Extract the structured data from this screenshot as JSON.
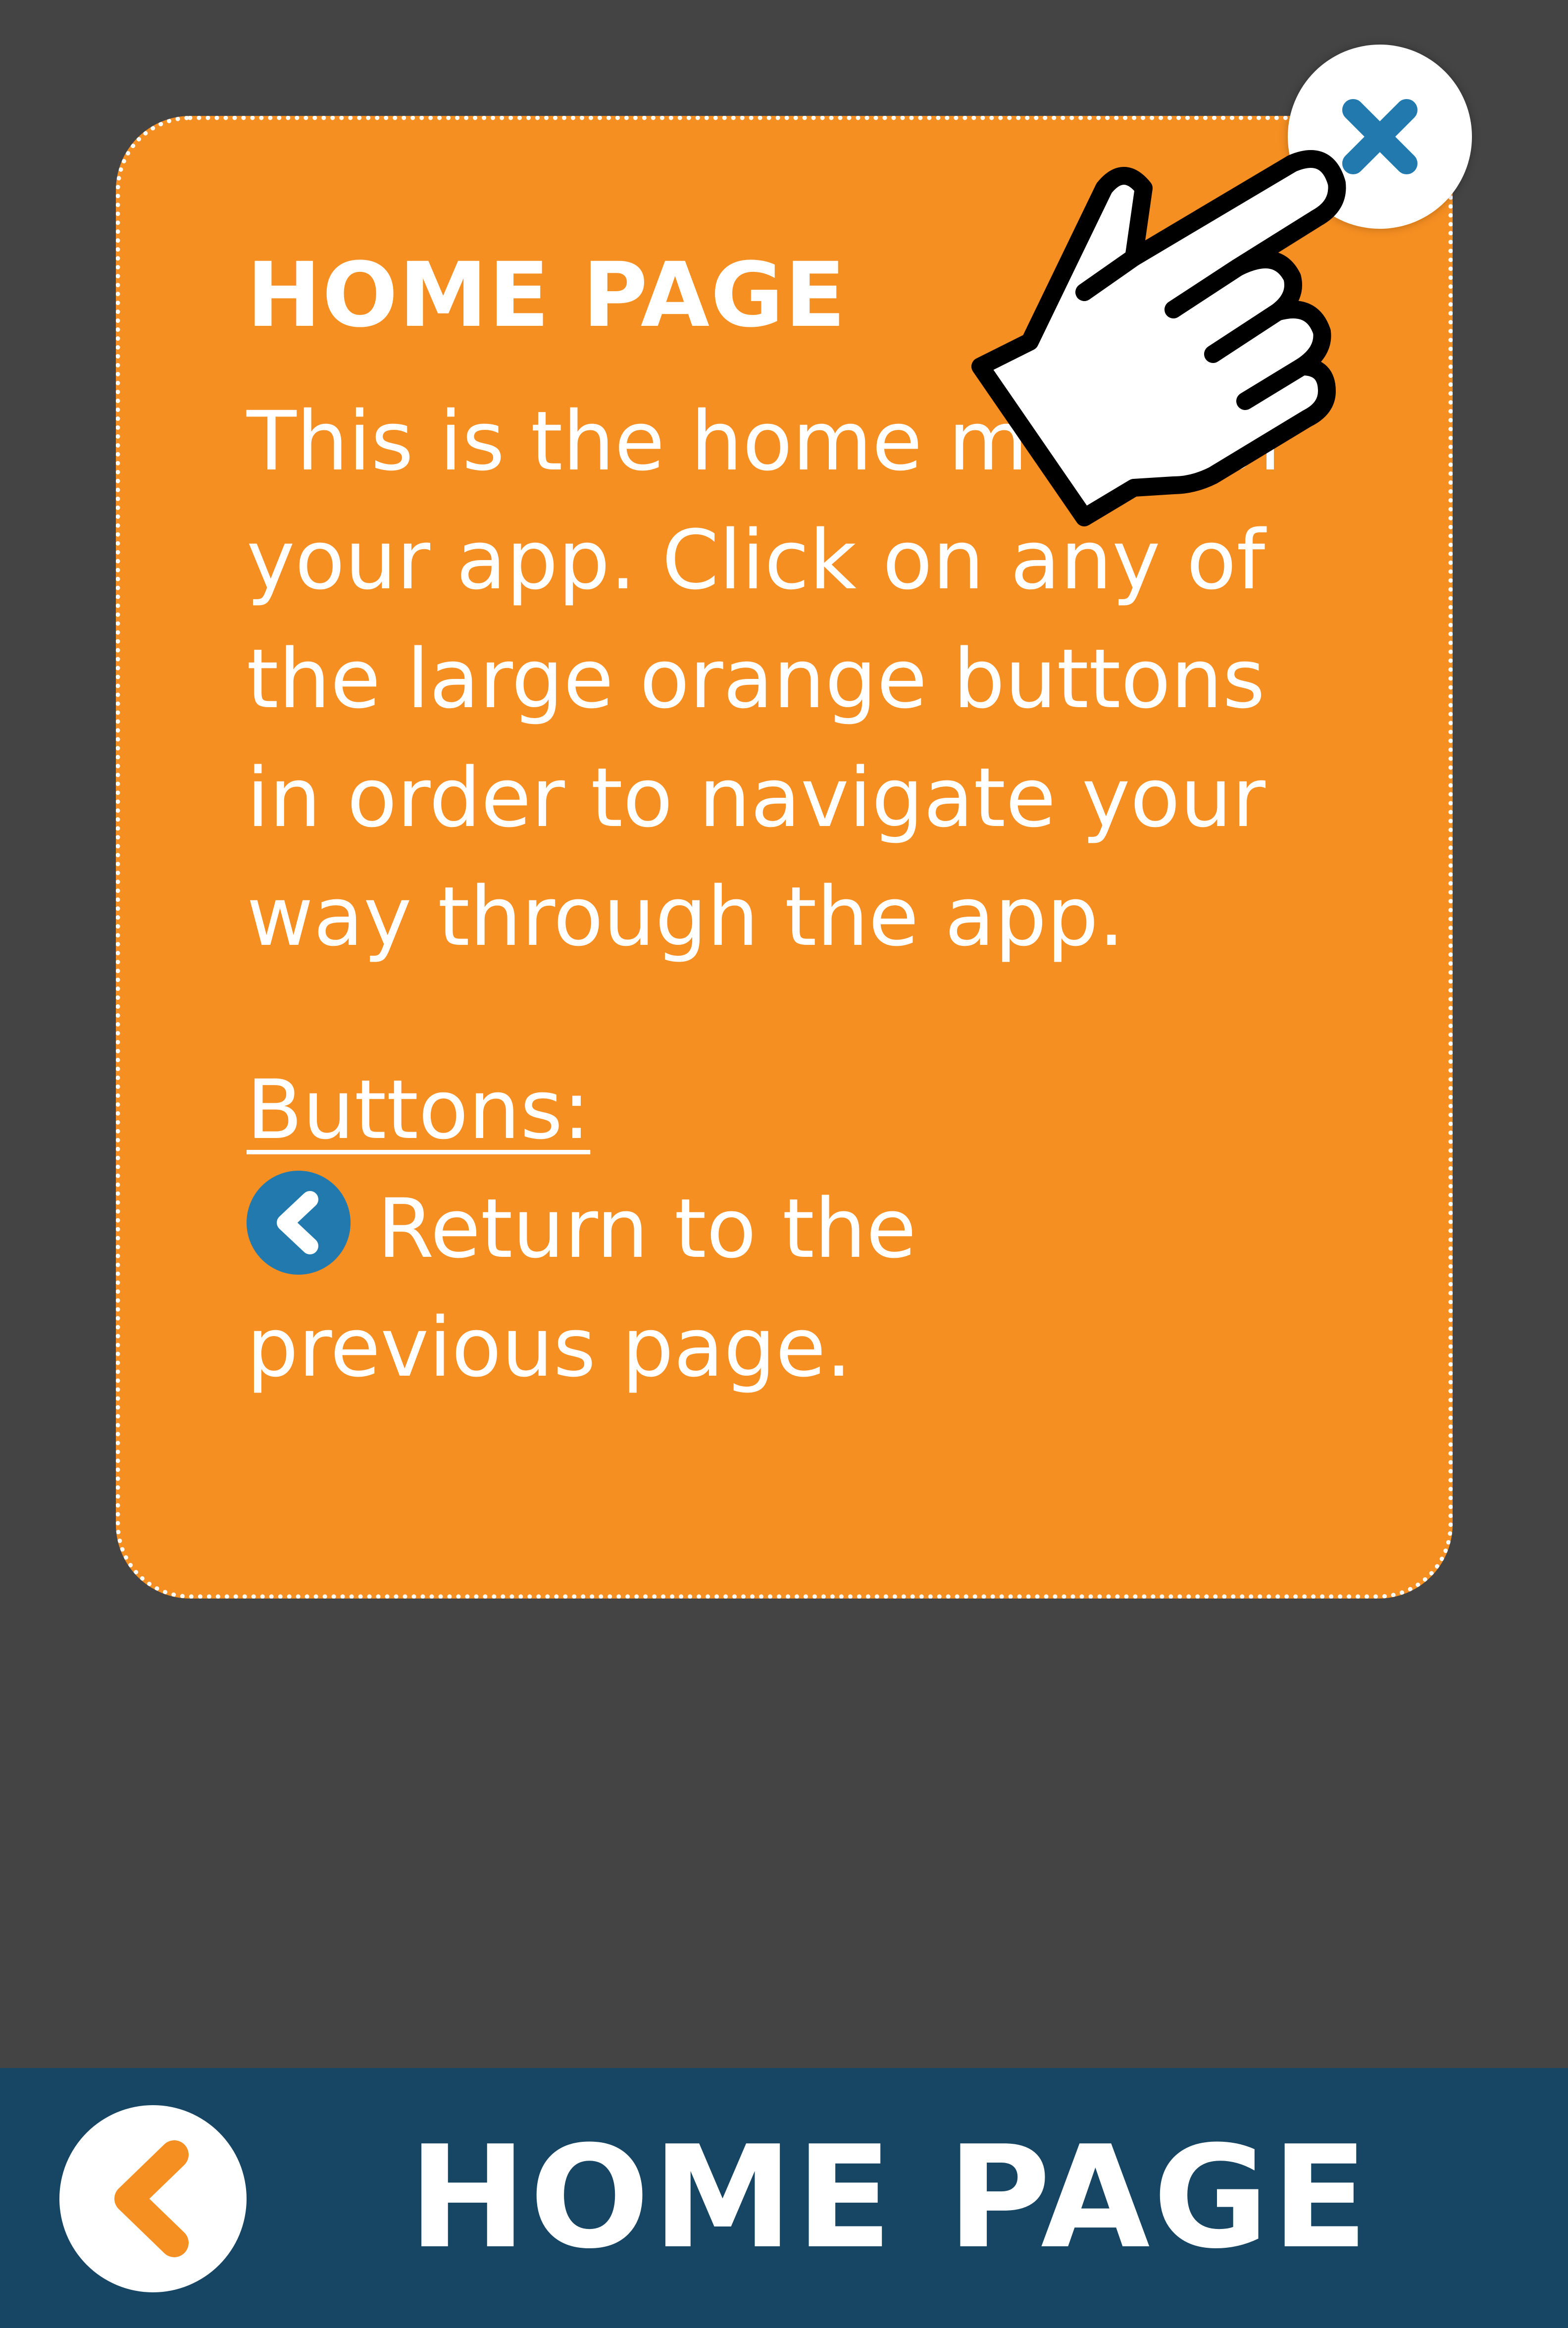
{
  "help_popup": {
    "title": "HOME PAGE",
    "description": "This is the home menu of your app. Click on any of the large orange buttons in order to navigate your way through the app.",
    "buttons_heading": "Buttons:",
    "back_button_legend": "Return to the previous page.",
    "close_icon": "close-x-icon"
  },
  "header": {
    "title": "HOME PAGE",
    "back_icon": "chevron-left-icon"
  },
  "colors": {
    "background": "#444444",
    "card": "#f68f22",
    "header_bar": "#164663",
    "accent_blue": "#2279ad",
    "back_chevron": "#f68f22"
  },
  "cursor_icon": "pointing-hand-icon"
}
